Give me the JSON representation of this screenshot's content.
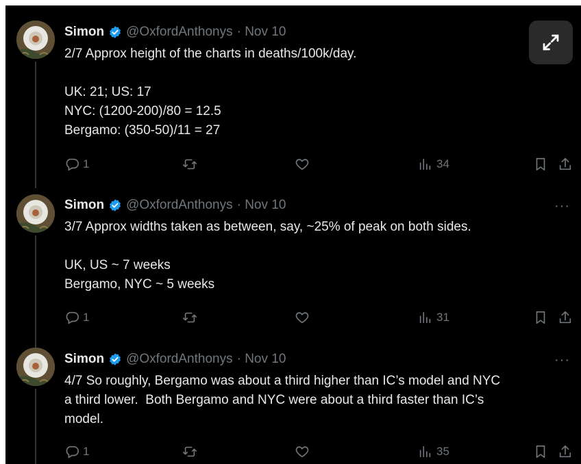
{
  "author": {
    "name": "Simon",
    "handle": "@OxfordAnthonys"
  },
  "icons": {
    "reply": "reply-icon",
    "retweet": "retweet-icon",
    "like": "heart-icon",
    "views": "views-icon",
    "bookmark": "bookmark-icon",
    "share": "share-icon",
    "expand": "expand-icon",
    "more": "more-icon",
    "verified": "verified-badge-icon"
  },
  "colors": {
    "background": "#000000",
    "text": "#e7e9ea",
    "muted": "#71767b",
    "verified": "#1d9bf0",
    "thread_line": "#333639"
  },
  "more_label": "···",
  "tweets": [
    {
      "date": "· Nov 10",
      "text": "2/7 Approx height of the charts in deaths/100k/day.\n\nUK: 21; US: 17\nNYC: (1200-200)/80 = 12.5\nBergamo: (350-50)/11 = 27",
      "replies": "1",
      "views": "34"
    },
    {
      "date": "· Nov 10",
      "text": "3/7 Approx widths taken as between, say, ~25% of peak on both sides.\n\nUK, US ~ 7 weeks\nBergamo, NYC ~ 5 weeks",
      "replies": "1",
      "views": "31"
    },
    {
      "date": "· Nov 10",
      "text": "4/7 So roughly, Bergamo was about a third higher than IC’s model and NYC\na third lower.  Both Bergamo and NYC were about a third faster than IC’s\nmodel.",
      "replies": "1",
      "views": "35"
    }
  ]
}
